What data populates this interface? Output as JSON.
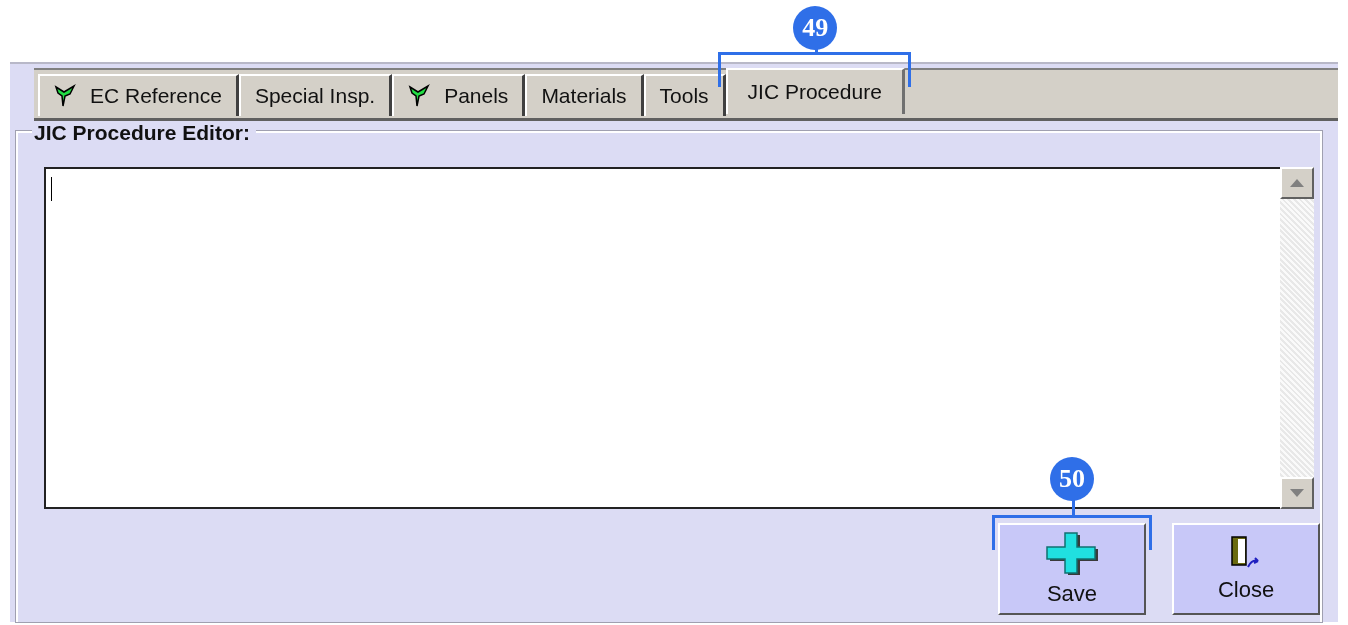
{
  "tabs": [
    {
      "label": "EC Reference",
      "has_icon": true,
      "selected": false
    },
    {
      "label": "Special Insp.",
      "has_icon": false,
      "selected": false
    },
    {
      "label": "Panels",
      "has_icon": true,
      "selected": false
    },
    {
      "label": "Materials",
      "has_icon": false,
      "selected": false
    },
    {
      "label": "Tools",
      "has_icon": false,
      "selected": false
    },
    {
      "label": "JIC Procedure",
      "has_icon": false,
      "selected": true,
      "callout": "49"
    }
  ],
  "editor": {
    "legend": "JIC Procedure Editor:"
  },
  "buttons": [
    {
      "label": "Save",
      "kind": "save",
      "callout": "50"
    },
    {
      "label": "Close",
      "kind": "close"
    }
  ]
}
